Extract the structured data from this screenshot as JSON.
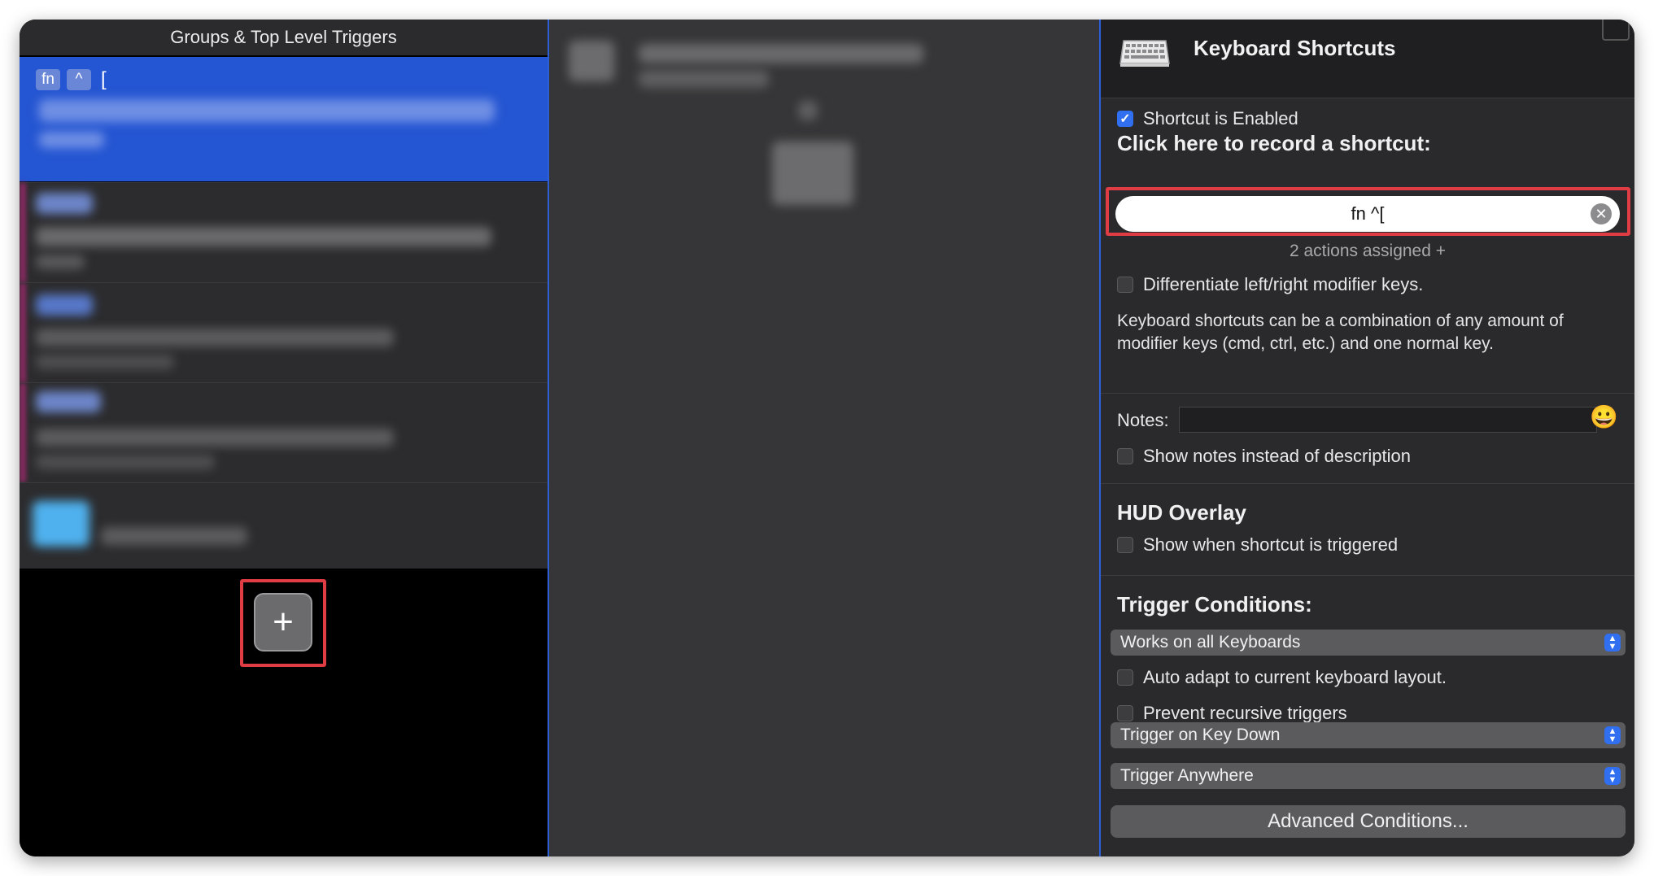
{
  "left_panel": {
    "header": "Groups & Top Level Triggers",
    "selected_trigger": {
      "keys": [
        "fn",
        "^"
      ],
      "bracket": "["
    },
    "add_button_label": "+"
  },
  "right_panel": {
    "title": "Keyboard Shortcuts",
    "shortcut_enabled_label": "Shortcut is Enabled",
    "shortcut_enabled": true,
    "record_heading": "Click here to record a shortcut:",
    "shortcut_value": "fn ^[",
    "clear_icon": "✕",
    "actions_assigned": "2 actions assigned +",
    "differentiate_label": "Differentiate left/right modifier keys.",
    "description": "Keyboard shortcuts can be a combination of any amount of modifier keys (cmd, ctrl, etc.) and one normal key.",
    "notes_label": "Notes:",
    "notes_value": "",
    "emoji": "😀",
    "show_notes_label": "Show notes instead of description",
    "hud_heading": "HUD Overlay",
    "hud_show_label": "Show when shortcut is triggered",
    "trigger_heading": "Trigger Conditions:",
    "keyboards_select": "Works on all Keyboards",
    "auto_adapt_label": "Auto adapt to current keyboard layout.",
    "prevent_recursive_label": "Prevent recursive triggers",
    "key_down_select": "Trigger on Key Down",
    "anywhere_select": "Trigger Anywhere",
    "advanced_button": "Advanced Conditions..."
  },
  "colors": {
    "selection_blue": "#2455d2",
    "highlight_red": "#e03c44",
    "accent_blue": "#2f6ff0"
  }
}
